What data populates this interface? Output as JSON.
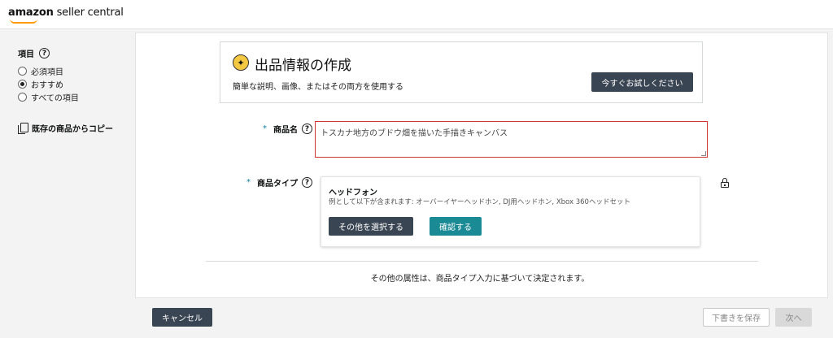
{
  "header": {
    "logo_bold": "amazon",
    "logo_rest": " seller central"
  },
  "sidebar": {
    "title": "項目",
    "options": [
      {
        "label": "必須項目",
        "selected": false
      },
      {
        "label": "おすすめ",
        "selected": true
      },
      {
        "label": "すべての項目",
        "selected": false
      }
    ],
    "copy_label": "既存の商品からコピー"
  },
  "promo": {
    "icon": "magic-wand-icon",
    "title": "出品情報の作成",
    "subtitle": "簡単な説明、画像、またはその両方を使用する",
    "button": "今すぐお試しください"
  },
  "fields": {
    "name_label": "商品名",
    "name_value": "トスカナ地方のブドウ畑を描いた手描きキャンバス",
    "type_label": "商品タイプ",
    "required_marker": "*"
  },
  "product_type": {
    "name": "ヘッドフォン",
    "description": "例として以下が含まれます: オーバーイヤーヘッドホン, DJ用ヘッドホン, Xbox 360ヘッドセット",
    "select_other": "その他を選択する",
    "confirm": "確認する"
  },
  "attributes_note": "その他の属性は、商品タイプ入力に基づいて決定されます。",
  "footer": {
    "cancel": "キャンセル",
    "save_draft": "下書きを保存",
    "next": "次へ"
  },
  "colors": {
    "dark_button": "#3a4553",
    "teal_button": "#1a8a95",
    "error_border": "#d0342c",
    "required_star": "#0d7fa0",
    "logo_smile": "#ff9900"
  }
}
